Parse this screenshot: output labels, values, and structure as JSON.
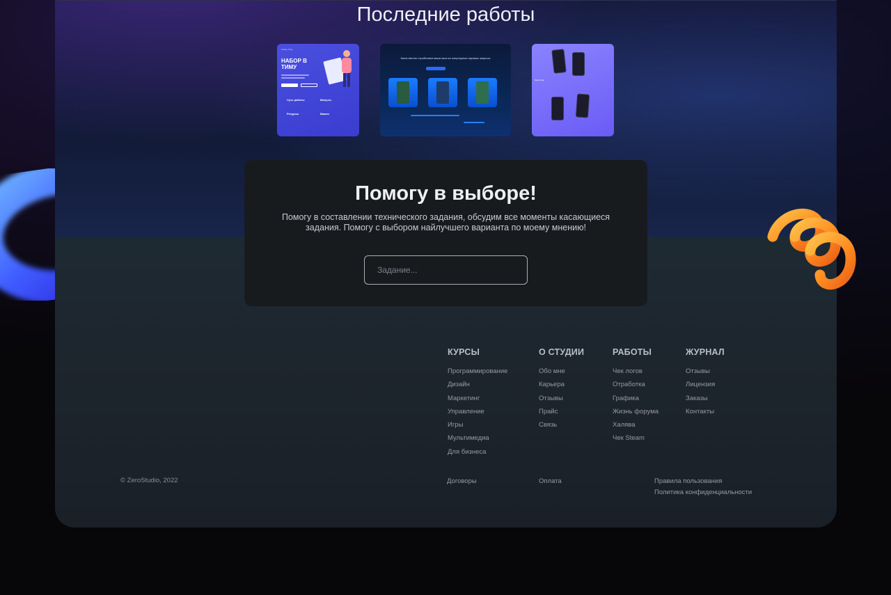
{
  "works": {
    "title": "Последние работы",
    "card1": {
      "brand": "Набор Тиму",
      "headline": "НАБОР В ТИМУ",
      "col1": "Суть работы",
      "col2": "Минуты",
      "col3": "Ресурсы",
      "col4": "Важно"
    },
    "card2": {
      "headline": "Качественно отработаем ваши ката на популярные игровые запросы"
    },
    "card3": {
      "caption": "Music App"
    }
  },
  "help": {
    "title": "Помогу в выборе!",
    "description": "Помогу в составлении технического задания, обсудим все моменты касающиеся задания. Помогу с выбором найлучшего варианта по моему мнению!",
    "input_placeholder": "Задание..."
  },
  "footer": {
    "columns": [
      {
        "title": "КУРСЫ",
        "links": [
          "Программирование",
          "Дизайн",
          "Маркетинг",
          "Управление",
          "Игры",
          "Мультимедиа",
          "Для бизнеса"
        ]
      },
      {
        "title": "О СТУДИИ",
        "links": [
          "Обо мне",
          "Карьера",
          "Отзывы",
          "Прайс",
          "Связь"
        ]
      },
      {
        "title": "РАБОТЫ",
        "links": [
          "Чек логов",
          "Отработка",
          "Графика",
          "Жизнь форума",
          "Халява",
          "Чек Steam"
        ]
      },
      {
        "title": "ЖУРНАЛ",
        "links": [
          "Отзывы",
          "Лицензия",
          "Заказы",
          "Контакты"
        ]
      }
    ],
    "copyright": "© ZeroStudio, 2022",
    "bottom_links": [
      "Договоры",
      "Оплата",
      "Правила пользования",
      "Политика конфиденциальности"
    ]
  },
  "colors": {
    "card_bg": "#181b1e",
    "accent_orange": "#ff8a1f",
    "accent_blue": "#3b5bff"
  }
}
